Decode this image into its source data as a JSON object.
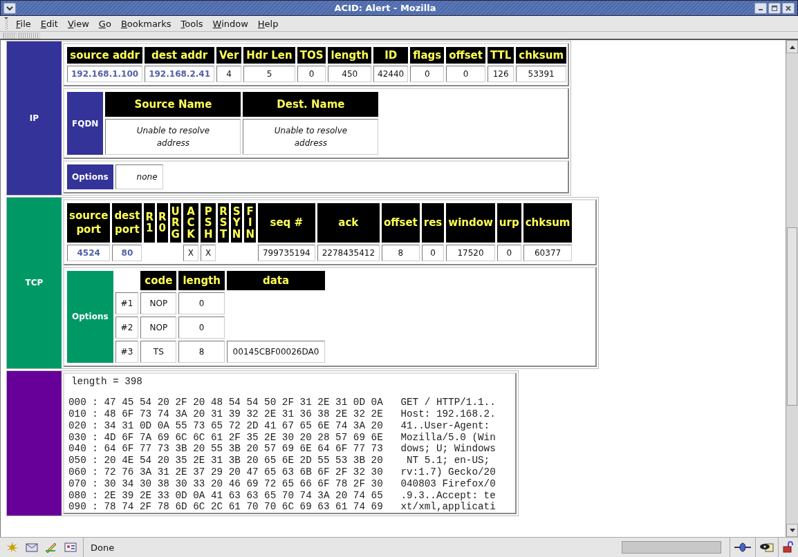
{
  "window": {
    "title": "ACID: Alert - Mozilla"
  },
  "menu": [
    {
      "label": "File"
    },
    {
      "label": "Edit"
    },
    {
      "label": "View"
    },
    {
      "label": "Go"
    },
    {
      "label": "Bookmarks"
    },
    {
      "label": "Tools"
    },
    {
      "label": "Window"
    },
    {
      "label": "Help"
    }
  ],
  "sections": [
    {
      "kind": "ip",
      "label": "IP",
      "color": "#333399",
      "header": [
        {
          "label": "source addr",
          "value": "192.168.1.100",
          "link": true
        },
        {
          "label": "dest addr",
          "value": "192.168.2.41",
          "link": true
        },
        {
          "label": "Ver",
          "value": "4",
          "link": false
        },
        {
          "label": "Hdr Len",
          "value": "5",
          "link": false
        },
        {
          "label": "TOS",
          "value": "0",
          "link": false
        },
        {
          "label": "length",
          "value": "450",
          "link": false
        },
        {
          "label": "ID",
          "value": "42440",
          "link": false
        },
        {
          "label": "flags",
          "value": "0",
          "link": false
        },
        {
          "label": "offset",
          "value": "0",
          "link": false
        },
        {
          "label": "TTL",
          "value": "126",
          "link": false
        },
        {
          "label": "chksum",
          "value": "53391",
          "link": false
        }
      ],
      "fqdn": {
        "label": "FQDN",
        "columns": [
          "Source Name",
          "Dest. Name"
        ],
        "values": [
          "Unable to resolve address",
          "Unable to resolve address"
        ]
      },
      "options": {
        "label": "Options",
        "value": "none"
      }
    },
    {
      "kind": "tcp",
      "label": "TCP",
      "color": "#009966",
      "header": [
        {
          "kind": "field",
          "label": "source port",
          "value": "4524",
          "link": true
        },
        {
          "kind": "field",
          "label": "dest port",
          "value": "80",
          "link": true
        },
        {
          "kind": "flag",
          "label": "R1"
        },
        {
          "kind": "flag",
          "label": "R0"
        },
        {
          "kind": "flag",
          "label": "URG"
        },
        {
          "kind": "flag",
          "label": "ACK",
          "value": "X"
        },
        {
          "kind": "flag",
          "label": "PSH",
          "value": "X"
        },
        {
          "kind": "flag",
          "label": "RST"
        },
        {
          "kind": "flag",
          "label": "SYN"
        },
        {
          "kind": "flag",
          "label": "FIN"
        },
        {
          "kind": "field",
          "label": "seq #",
          "value": "799735194",
          "link": false
        },
        {
          "kind": "field",
          "label": "ack",
          "value": "2278435412",
          "link": false
        },
        {
          "kind": "field",
          "label": "offset",
          "value": "8",
          "link": false
        },
        {
          "kind": "field",
          "label": "res",
          "value": "0",
          "link": false
        },
        {
          "kind": "field",
          "label": "window",
          "value": "17520",
          "link": false
        },
        {
          "kind": "field",
          "label": "urp",
          "value": "0",
          "link": false
        },
        {
          "kind": "field",
          "label": "chksum",
          "value": "60377",
          "link": false
        }
      ],
      "options": {
        "label": "Options",
        "columns": [
          "code",
          "length",
          "data"
        ],
        "rows": [
          {
            "index": "#1",
            "code": "NOP",
            "length": "0"
          },
          {
            "index": "#2",
            "code": "NOP",
            "length": "0"
          },
          {
            "index": "#3",
            "code": "TS",
            "length": "8",
            "data": "00145CBF00026DA0"
          }
        ]
      }
    },
    {
      "kind": "payload",
      "color": "#660099",
      "length_line": "length = 398",
      "lines": [
        "000 : 47 45 54 20 2F 20 48 54 54 50 2F 31 2E 31 0D 0A   GET / HTTP/1.1..",
        "010 : 48 6F 73 74 3A 20 31 39 32 2E 31 36 38 2E 32 2E   Host: 192.168.2.",
        "020 : 34 31 0D 0A 55 73 65 72 2D 41 67 65 6E 74 3A 20   41..User-Agent: ",
        "030 : 4D 6F 7A 69 6C 6C 61 2F 35 2E 30 20 28 57 69 6E   Mozilla/5.0 (Win",
        "040 : 64 6F 77 73 3B 20 55 3B 20 57 69 6E 64 6F 77 73   dows; U; Windows",
        "050 : 20 4E 54 20 35 2E 31 3B 20 65 6E 2D 55 53 3B 20    NT 5.1; en-US; ",
        "060 : 72 76 3A 31 2E 37 29 20 47 65 63 6B 6F 2F 32 30   rv:1.7) Gecko/20",
        "070 : 30 34 30 38 30 33 20 46 69 72 65 66 6F 78 2F 30   040803 Firefox/0",
        "080 : 2E 39 2E 33 0D 0A 41 63 63 65 70 74 3A 20 74 65   .9.3..Accept: te",
        "090 : 78 74 2F 78 6D 6C 2C 61 70 70 6C 69 63 61 74 69   xt/xml,applicati"
      ]
    }
  ],
  "status_bar": {
    "text": "Done"
  }
}
